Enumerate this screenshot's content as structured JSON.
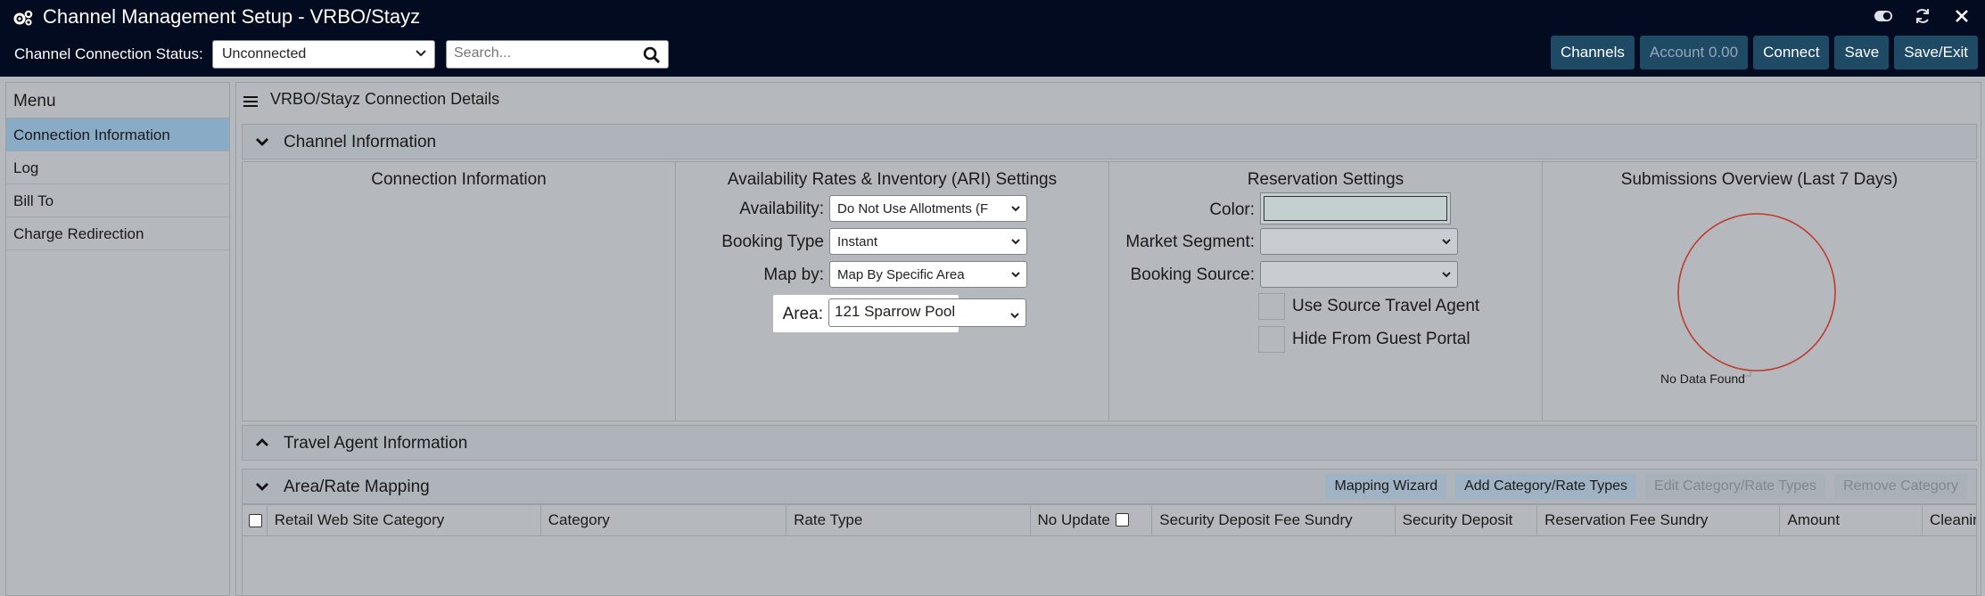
{
  "app": {
    "title": "Channel Management Setup - VRBO/Stayz",
    "icon": "gears-icon"
  },
  "window_controls": [
    "toggle-icon",
    "refresh-icon",
    "close-icon"
  ],
  "status_bar": {
    "label": "Channel Connection Status:",
    "status_value": "Unconnected",
    "search_placeholder": "Search..."
  },
  "top_buttons": {
    "channels": "Channels",
    "account": "Account 0.00",
    "connect": "Connect",
    "save": "Save",
    "save_exit": "Save/Exit"
  },
  "sidebar": {
    "heading": "Menu",
    "items": [
      {
        "label": "Connection Information",
        "active": true
      },
      {
        "label": "Log",
        "active": false
      },
      {
        "label": "Bill To",
        "active": false
      },
      {
        "label": "Charge Redirection",
        "active": false
      }
    ]
  },
  "main": {
    "title": "VRBO/Stayz Connection Details",
    "channel_info": {
      "title": "Channel Information",
      "col_connection": "Connection Information",
      "col_ari": "Availability Rates & Inventory (ARI) Settings",
      "col_reservation": "Reservation Settings",
      "col_submissions": "Submissions Overview (Last 7 Days)",
      "ari": {
        "availability_label": "Availability:",
        "availability_value": "Do Not Use Allotments (F",
        "booking_type_label": "Booking Type",
        "booking_type_value": "Instant",
        "map_by_label": "Map by:",
        "map_by_value": "Map By Specific Area",
        "area_label": "Area:",
        "area_value": "121 Sparrow Pool"
      },
      "reservation": {
        "color_label": "Color:",
        "color_value": "#c4d0d0",
        "market_segment_label": "Market Segment:",
        "market_segment_value": "",
        "booking_source_label": "Booking Source:",
        "booking_source_value": "",
        "use_source_travel_agent": "Use Source Travel Agent",
        "hide_from_guest_portal": "Hide From Guest Portal"
      },
      "submissions": {
        "no_data": "No Data Found",
        "ring_color": "#c0392b"
      }
    },
    "travel_agent": {
      "title": "Travel Agent Information"
    },
    "area_rate": {
      "title": "Area/Rate Mapping",
      "buttons": {
        "mapping_wizard": "Mapping Wizard",
        "add_category": "Add Category/Rate Types",
        "edit_category": "Edit Category/Rate Types",
        "remove_category": "Remove Category"
      },
      "columns": [
        "Retail Web Site Category",
        "Category",
        "Rate Type",
        "No Update",
        "Security Deposit Fee Sundry",
        "Security Deposit",
        "Reservation Fee Sundry",
        "Amount",
        "Cleaning"
      ]
    }
  }
}
